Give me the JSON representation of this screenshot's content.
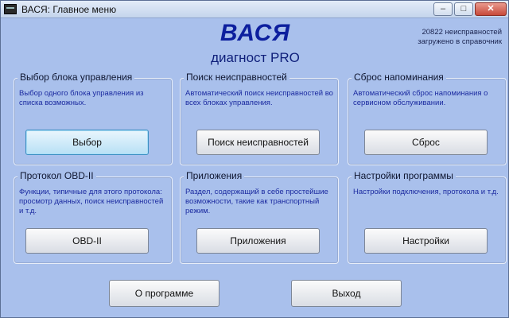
{
  "window": {
    "title": "ВАСЯ:  Главное меню",
    "min_glyph": "‒",
    "max_glyph": "□",
    "close_glyph": "✕"
  },
  "header": {
    "title": "ВАСЯ",
    "subtitle": "диагност PRO",
    "info_line1": "20822 неисправностей",
    "info_line2": "загружено в справочник"
  },
  "panels": [
    {
      "title": "Выбор блока управления",
      "description": "Выбор одного блока управления из списка возможных.",
      "button": "Выбор"
    },
    {
      "title": "Поиск неисправностей",
      "description": "Автоматический поиск неисправностей во всех блоках управления.",
      "button": "Поиск неисправностей"
    },
    {
      "title": "Сброс напоминания",
      "description": "Автоматический сброс напоминания о сервисном обслуживании.",
      "button": "Сброс"
    },
    {
      "title": "Протокол OBD-II",
      "description": "Функции, типичные для этого протокола: просмотр данных, поиск неисправностей и т.д.",
      "button": "OBD-II"
    },
    {
      "title": "Приложения",
      "description": "Раздел, содержащий в себе простейшие возможности, такие как транспортный режим.",
      "button": "Приложения"
    },
    {
      "title": "Настройки программы",
      "description": "Настройки подключения, протокола и т.д.",
      "button": "Настройки"
    }
  ],
  "footer": {
    "about_label": "О программе",
    "exit_label": "Выход"
  }
}
